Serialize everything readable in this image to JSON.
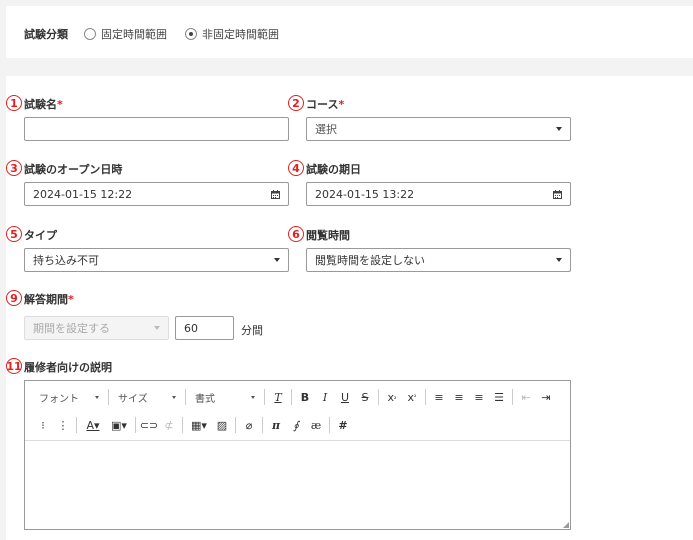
{
  "exam_category": {
    "label": "試験分類",
    "options": [
      {
        "label": "固定時間範囲",
        "selected": false
      },
      {
        "label": "非固定時間範囲",
        "selected": true
      }
    ]
  },
  "fields": {
    "exam_name": {
      "marker": "1",
      "label": "試験名",
      "required": "*",
      "value": ""
    },
    "course": {
      "marker": "2",
      "label": "コース",
      "required": "*",
      "value": "選択"
    },
    "open_datetime": {
      "marker": "3",
      "label": "試験のオープン日時",
      "value": "2024-01-15 12:22"
    },
    "due_date": {
      "marker": "4",
      "label": "試験の期日",
      "value": "2024-01-15 13:22"
    },
    "type": {
      "marker": "5",
      "label": "タイプ",
      "value": "持ち込み不可"
    },
    "view_time": {
      "marker": "6",
      "label": "閲覧時間",
      "value": "閲覧時間を設定しない"
    },
    "answer_period": {
      "marker": "9",
      "label": "解答期間",
      "required": "*",
      "select_value": "期間を設定する",
      "minutes": "60",
      "unit": "分間"
    },
    "description": {
      "marker": "11",
      "label": "履修者向けの説明"
    }
  },
  "editor_toolbar": {
    "font": "フォント",
    "size": "サイズ",
    "format": "書式"
  },
  "colors": {
    "marker": "#e02020",
    "background": "#f3f3f3"
  }
}
